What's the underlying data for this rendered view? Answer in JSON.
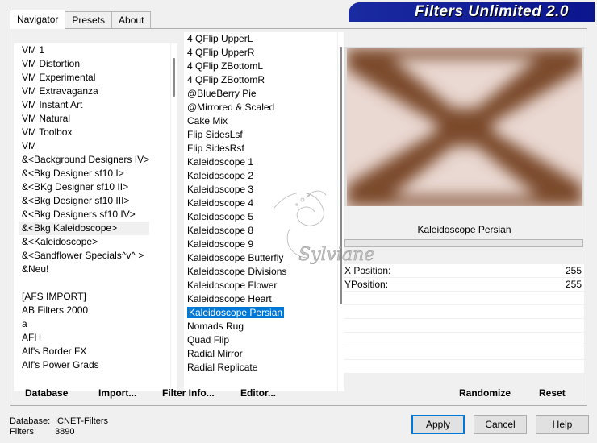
{
  "window": {
    "title": "Filters Unlimited 2.0"
  },
  "tabs": [
    {
      "label": "Navigator",
      "active": true
    },
    {
      "label": "Presets",
      "active": false
    },
    {
      "label": "About",
      "active": false
    }
  ],
  "categories": [
    "VM 1",
    "VM Distortion",
    "VM Experimental",
    "VM Extravaganza",
    "VM Instant Art",
    "VM Natural",
    "VM Toolbox",
    "VM",
    "&<Background Designers IV>",
    "&<Bkg Designer sf10 I>",
    "&<BKg Designer sf10 II>",
    "&<Bkg Designer sf10 III>",
    "&<Bkg Designers sf10 IV>",
    "&<Bkg Kaleidoscope>",
    "&<Kaleidoscope>",
    "&<Sandflower Specials^v^ >",
    "&Neu!",
    "",
    "[AFS IMPORT]",
    "AB Filters 2000",
    "a",
    "AFH",
    "Alf's Border FX",
    "Alf's Power Grads"
  ],
  "selected_category": "&<Bkg Kaleidoscope>",
  "filters": [
    "4 QFlip UpperL",
    "4 QFlip UpperR",
    "4 QFlip ZBottomL",
    "4 QFlip ZBottomR",
    "@BlueBerry Pie",
    "@Mirrored & Scaled",
    "Cake Mix",
    "Flip SidesLsf",
    "Flip SidesRsf",
    "Kaleidoscope 1",
    "Kaleidoscope 2",
    "Kaleidoscope 3",
    "Kaleidoscope 4",
    "Kaleidoscope 5",
    "Kaleidoscope 8",
    "Kaleidoscope 9",
    "Kaleidoscope Butterfly",
    "Kaleidoscope Divisions",
    "Kaleidoscope Flower",
    "Kaleidoscope Heart",
    "Kaleidoscope Persian",
    "Nomads Rug",
    "Quad Flip",
    "Radial Mirror",
    "Radial Replicate"
  ],
  "selected_filter": "Kaleidoscope Persian",
  "preview": {
    "filter_name": "Kaleidoscope Persian",
    "colors": {
      "light": "#ead8d2",
      "dark": "#7a4a2a"
    }
  },
  "params": [
    {
      "label": "X Position:",
      "value": "255"
    },
    {
      "label": "YPosition:",
      "value": "255"
    }
  ],
  "toolbar": {
    "database": "Database",
    "import": "Import...",
    "filter_info": "Filter Info...",
    "editor": "Editor...",
    "randomize": "Randomize",
    "reset": "Reset"
  },
  "status": {
    "database_label": "Database:",
    "database_value": "ICNET-Filters",
    "filters_label": "Filters:",
    "filters_value": "3890"
  },
  "buttons": {
    "apply": "Apply",
    "cancel": "Cancel",
    "help": "Help"
  },
  "watermark_text": "Sylviane"
}
